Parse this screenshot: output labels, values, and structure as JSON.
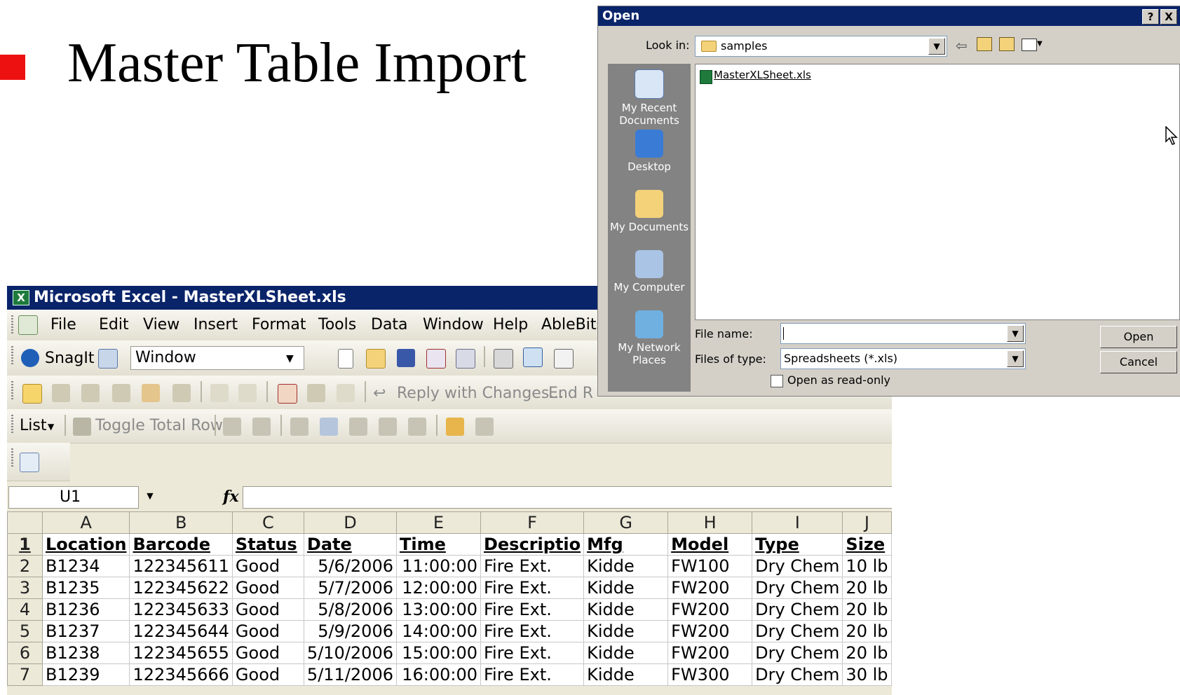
{
  "slide": {
    "title": "Master Table Import",
    "bullet_color": "#ee1111"
  },
  "excel": {
    "title": "Microsoft Excel - MasterXLSheet.xls",
    "menu": [
      "File",
      "Edit",
      "View",
      "Insert",
      "Format",
      "Tools",
      "Data",
      "Window",
      "Help",
      "AbleBits"
    ],
    "snagit_label": "SnagIt",
    "snagit_combo_value": "Window",
    "reply_label": "Reply with Changes...",
    "end_review_label": "End R",
    "list_label": "List",
    "toggle_total_row_label": "Toggle Total Row",
    "name_box": "U1",
    "fx_label": "fx",
    "columns": [
      "A",
      "B",
      "C",
      "D",
      "E",
      "F",
      "G",
      "H",
      "I",
      "J"
    ],
    "header_row": [
      "Location",
      "Barcode",
      "Status",
      "Date",
      "Time",
      "Descriptio",
      "Mfg",
      "Model",
      "Type",
      "Size"
    ],
    "rows": [
      {
        "num": "1"
      },
      {
        "num": "2",
        "cells": [
          "B1234",
          "122345611",
          "Good",
          "5/6/2006",
          "11:00:00",
          "Fire Ext.",
          "Kidde",
          "FW100",
          "Dry Chem",
          "10 lb"
        ]
      },
      {
        "num": "3",
        "cells": [
          "B1235",
          "122345622",
          "Good",
          "5/7/2006",
          "12:00:00",
          "Fire Ext.",
          "Kidde",
          "FW200",
          "Dry Chem",
          "20 lb"
        ]
      },
      {
        "num": "4",
        "cells": [
          "B1236",
          "122345633",
          "Good",
          "5/8/2006",
          "13:00:00",
          "Fire Ext.",
          "Kidde",
          "FW200",
          "Dry Chem",
          "20 lb"
        ]
      },
      {
        "num": "5",
        "cells": [
          "B1237",
          "122345644",
          "Good",
          "5/9/2006",
          "14:00:00",
          "Fire Ext.",
          "Kidde",
          "FW200",
          "Dry Chem",
          "20 lb"
        ]
      },
      {
        "num": "6",
        "cells": [
          "B1238",
          "122345655",
          "Good",
          "5/10/2006",
          "15:00:00",
          "Fire Ext.",
          "Kidde",
          "FW200",
          "Dry Chem",
          "20 lb"
        ]
      },
      {
        "num": "7",
        "cells": [
          "B1239",
          "122345666",
          "Good",
          "5/11/2006",
          "16:00:00",
          "Fire Ext.",
          "Kidde",
          "FW300",
          "Dry Chem",
          "30 lb"
        ]
      }
    ]
  },
  "dialog": {
    "title": "Open",
    "help_btn": "?",
    "close_btn": "X",
    "look_in_label": "Look in:",
    "look_in_value": "samples",
    "places": [
      "My Recent Documents",
      "Desktop",
      "My Documents",
      "My Computer",
      "My Network Places"
    ],
    "file": "MasterXLSheet.xls",
    "file_name_label": "File name:",
    "file_name_value": "",
    "files_of_type_label": "Files of type:",
    "files_of_type_value": "Spreadsheets (*.xls)",
    "read_only_label": "Open as read-only",
    "open_button": "Open",
    "cancel_button": "Cancel"
  },
  "colors": {
    "titlebar": "#0a246a",
    "excel_green": "#1e7b3c"
  }
}
